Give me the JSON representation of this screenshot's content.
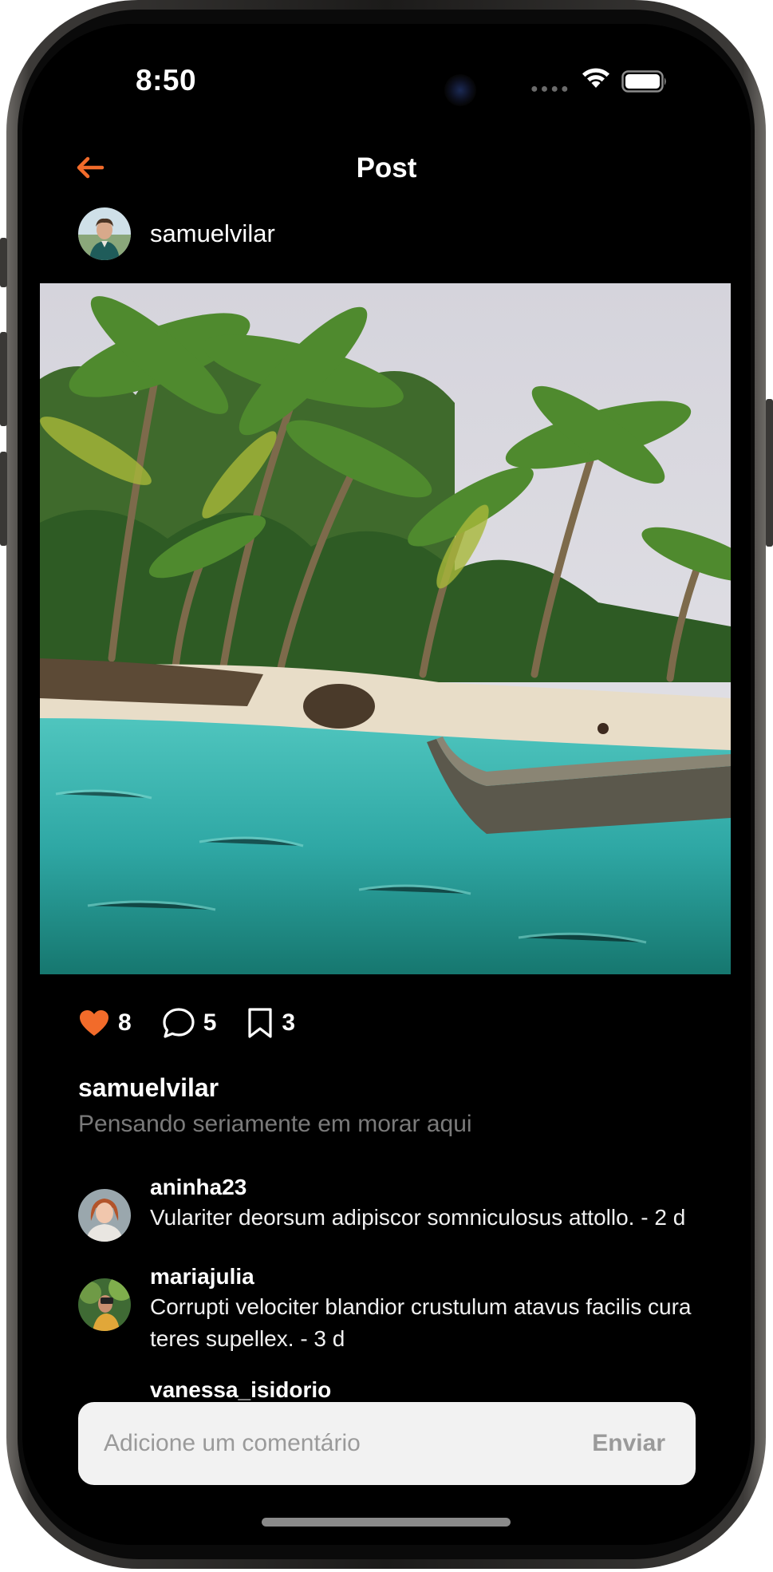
{
  "status_bar": {
    "time": "8:50",
    "signal_icon": "signal-dots-icon",
    "wifi_icon": "wifi-icon",
    "battery_icon": "battery-icon"
  },
  "nav": {
    "back_icon": "arrow-left-icon",
    "title": "Post"
  },
  "post": {
    "author": "samuelvilar",
    "image_alt_icon": "beach-photo",
    "likes_count": "8",
    "comments_count": "5",
    "saves_count": "3",
    "caption_user": "samuelvilar",
    "caption_text": "Pensando seriamente em morar aqui"
  },
  "comments": [
    {
      "user": "aninha23",
      "text": "Vulariter deorsum adipiscor somniculosus attollo. - 2 d"
    },
    {
      "user": "mariajulia",
      "text": "Corrupti velociter blandior crustulum atavus facilis cura teres supellex. - 3 d"
    },
    {
      "user": "vanessa_isidorio",
      "text": ""
    }
  ],
  "comment_bar": {
    "placeholder": "Adicione um comentário",
    "send_label": "Enviar"
  },
  "colors": {
    "accent": "#F26B2A",
    "background": "#000000",
    "muted_text": "#7A7A7A",
    "input_bg": "#F2F2F2"
  }
}
